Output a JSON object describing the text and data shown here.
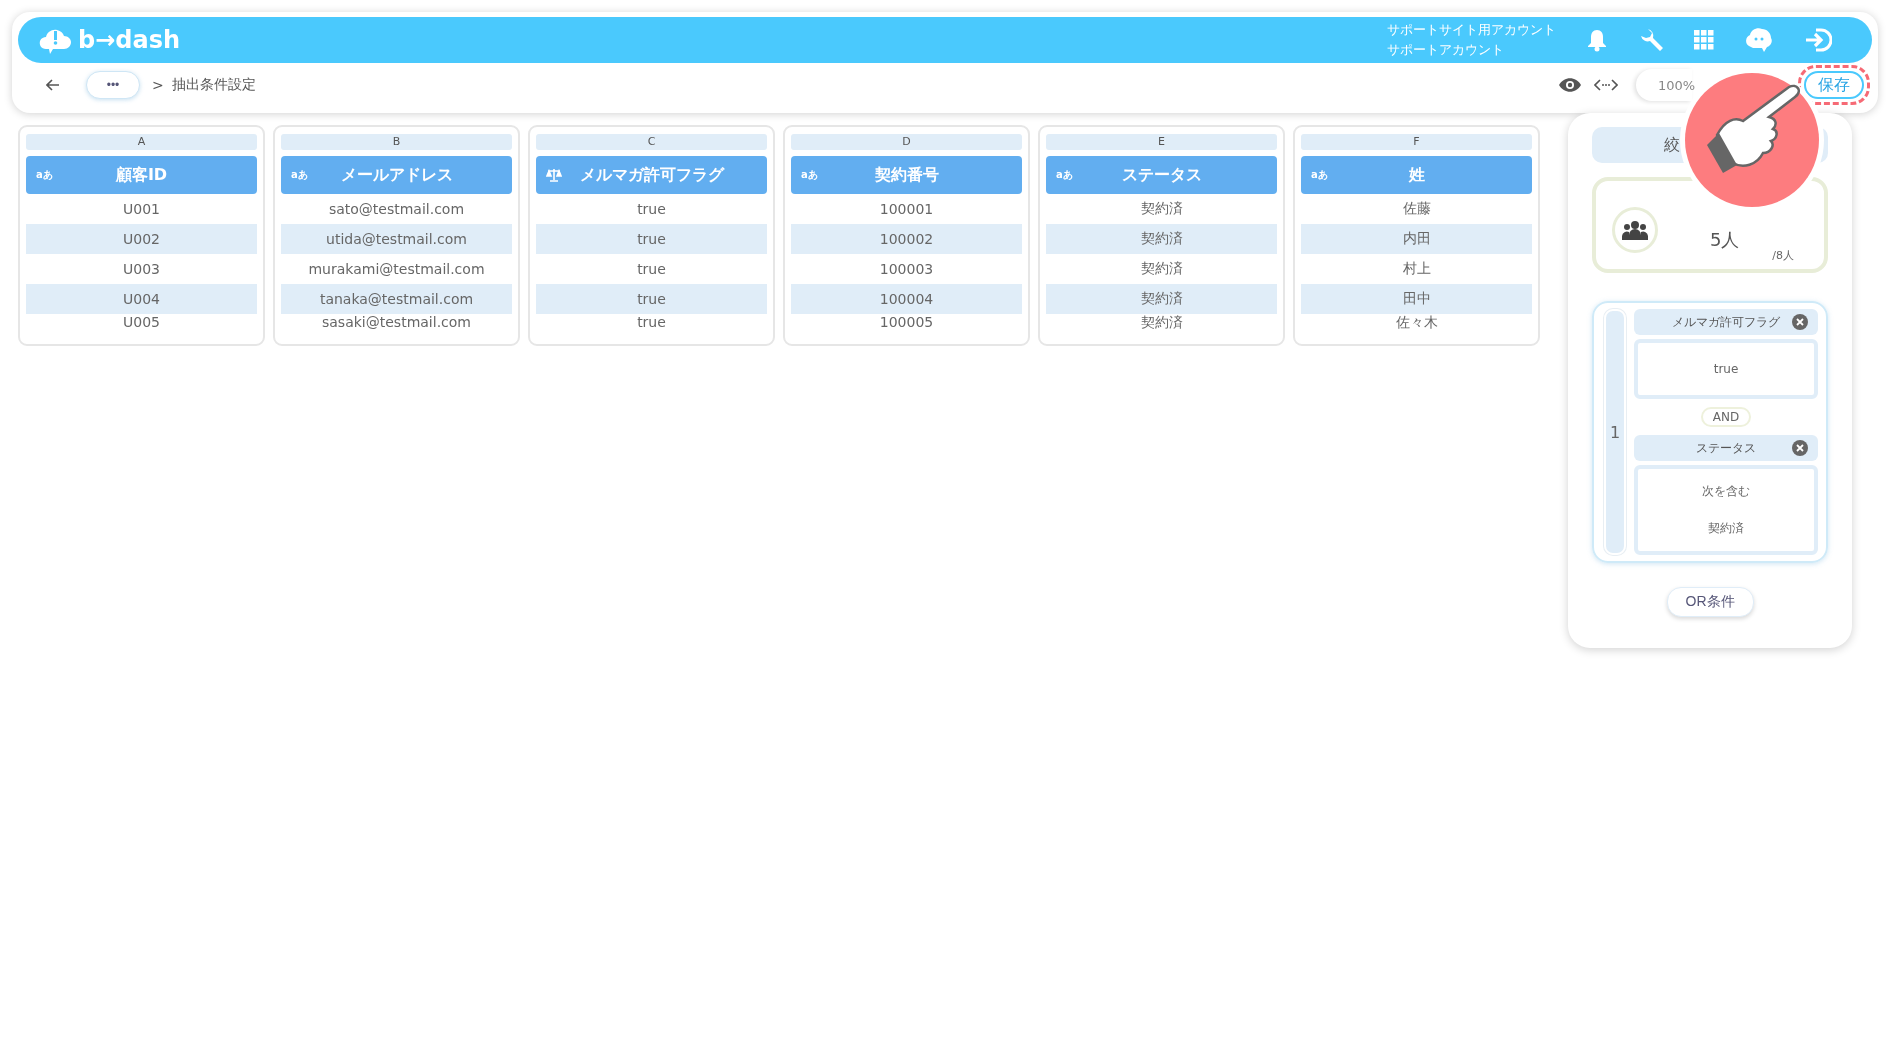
{
  "header": {
    "logo": "b→dash",
    "account_lines": [
      "サポートサイト用アカウント",
      "サポートアカウント"
    ]
  },
  "toolbar": {
    "more": "•••",
    "breadcrumb_separator": ">",
    "breadcrumb": "抽出条件設定",
    "zoom": "100%",
    "save": "保存"
  },
  "columns": [
    {
      "letter": "A",
      "kind": "text",
      "type_label": "aあ",
      "title": "顧客ID",
      "cells": [
        "U001",
        "U002",
        "U003",
        "U004",
        "U005"
      ]
    },
    {
      "letter": "B",
      "kind": "text",
      "type_label": "aあ",
      "title": "メールアドレス",
      "cells": [
        "sato@testmail.com",
        "utida@testmail.com",
        "murakami@testmail.com",
        "tanaka@testmail.com",
        "sasaki@testmail.com"
      ]
    },
    {
      "letter": "C",
      "kind": "flag",
      "title": "メルマガ許可フラグ",
      "cells": [
        "true",
        "true",
        "true",
        "true",
        "true"
      ]
    },
    {
      "letter": "D",
      "kind": "text",
      "type_label": "aあ",
      "title": "契約番号",
      "cells": [
        "100001",
        "100002",
        "100003",
        "100004",
        "100005"
      ]
    },
    {
      "letter": "E",
      "kind": "text",
      "type_label": "aあ",
      "title": "ステータス",
      "cells": [
        "契約済",
        "契約済",
        "契約済",
        "契約済",
        "契約済"
      ]
    },
    {
      "letter": "F",
      "kind": "text",
      "type_label": "aあ",
      "title": "姓",
      "cells": [
        "佐藤",
        "内田",
        "村上",
        "田中",
        "佐々木"
      ]
    }
  ],
  "panel": {
    "title": "絞",
    "count": "5人",
    "total": "/8人",
    "group_number": "1",
    "conditions": [
      {
        "field": "メルマガ許可フラグ",
        "values": [
          "true"
        ]
      },
      {
        "field": "ステータス",
        "values": [
          "次を含む",
          "契約済"
        ]
      }
    ],
    "joiner": "AND",
    "or_button": "OR条件"
  }
}
